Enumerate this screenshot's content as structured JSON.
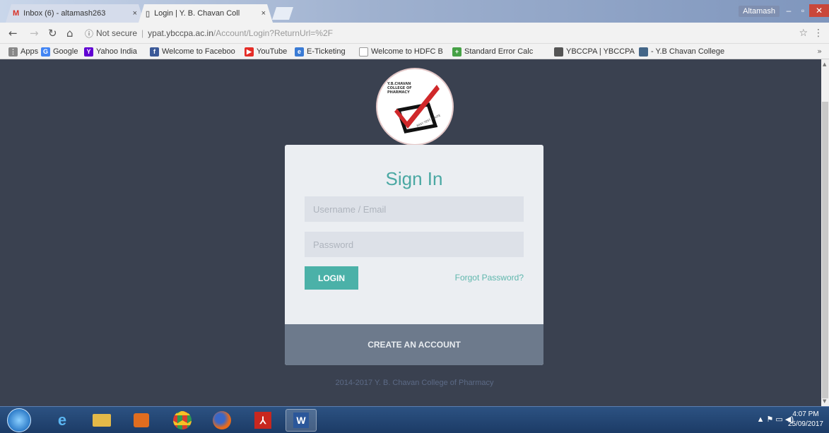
{
  "browser": {
    "tabs": [
      {
        "label": "Inbox (6) - altamash263",
        "icon": "gmail-icon"
      },
      {
        "label": "Login | Y. B. Chavan Coll",
        "icon": "page-icon"
      }
    ],
    "user_chip": "Altamash",
    "address": {
      "security": "Not secure",
      "url_host": "ypat.ybccpa.ac.in",
      "url_path": "/Account/Login?ReturnUrl=%2F"
    },
    "bookmarks": [
      {
        "label": "Apps",
        "icon": "apps-icon",
        "color": "#666666"
      },
      {
        "label": "Google",
        "icon": "google-icon",
        "color": "#4285f4"
      },
      {
        "label": "Yahoo India",
        "icon": "yahoo-icon",
        "color": "#6001d2"
      },
      {
        "label": "Welcome to Faceboo",
        "icon": "facebook-icon",
        "color": "#3b5998"
      },
      {
        "label": "YouTube",
        "icon": "youtube-icon",
        "color": "#e52d27"
      },
      {
        "label": "E-Ticketing",
        "icon": "irctc-icon",
        "color": "#3a7bd5"
      },
      {
        "label": "Welcome to HDFC B",
        "icon": "page-icon",
        "color": "#999999"
      },
      {
        "label": "Standard Error Calc",
        "icon": "calc-icon",
        "color": "#46a146"
      },
      {
        "label": "YBCCPA | YBCCPA",
        "icon": "ybccpa-icon",
        "color": "#555555"
      },
      {
        "label": "- Y.B Chavan College",
        "icon": "college-icon",
        "color": "#446688"
      }
    ],
    "bookmarks_more": "»"
  },
  "login": {
    "title": "Sign In",
    "username_placeholder": "Username / Email",
    "password_placeholder": "Password",
    "login_button": "LOGIN",
    "forgot_link": "Forgot Password?",
    "create_account": "CREATE AN ACCOUNT",
    "copyright": "2014-2017 Y. B. Chavan College of Pharmacy"
  },
  "logo": {
    "text_top": "Y.B.CHAVAN COLLEGE OF PHARMACY",
    "text_bottom": "EASY TEST ROUTE"
  },
  "taskbar": {
    "apps": [
      {
        "name": "ie",
        "icon": "ie-icon",
        "color": "#2b7cd3"
      },
      {
        "name": "explorer",
        "icon": "folder-icon",
        "color": "#e4b948"
      },
      {
        "name": "media",
        "icon": "media-player-icon",
        "color": "#e06d1f"
      },
      {
        "name": "chrome",
        "icon": "chrome-icon",
        "color": "#d93b2e"
      },
      {
        "name": "firefox",
        "icon": "firefox-icon",
        "color": "#e66a1c"
      },
      {
        "name": "acrobat",
        "icon": "acrobat-icon",
        "color": "#c8271f"
      },
      {
        "name": "word",
        "icon": "word-icon",
        "color": "#2b579a"
      }
    ],
    "time": "4:07 PM",
    "date": "25/09/2017"
  },
  "colors": {
    "page_bg": "#3a4150",
    "accent": "#4bb1a8",
    "card_bg": "#ebeef2",
    "card_footer": "#6d7a8c"
  }
}
